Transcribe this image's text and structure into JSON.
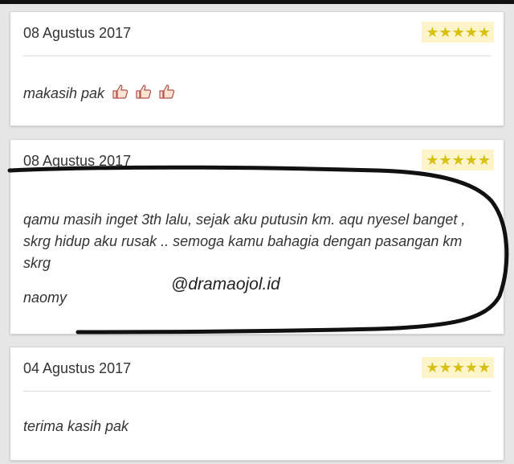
{
  "reviews": [
    {
      "date": "08 Agustus 2017",
      "stars": "★★★★★",
      "text": "makasih pak",
      "emoji": "thumbs-up-icon"
    },
    {
      "date": "08 Agustus 2017",
      "stars": "★★★★★",
      "text": "qamu masih inget 3th lalu, sejak aku putusin km. aqu nyesel banget , skrg hidup aku rusak .. semoga kamu bahagia dengan pasangan km skrg",
      "signature": "naomy"
    },
    {
      "date": "04 Agustus 2017",
      "stars": "★★★★★",
      "text": "terima kasih pak"
    }
  ],
  "watermark": "@dramaojol.id",
  "colors": {
    "star": "#d8c012",
    "star_bg": "#fdf5c9",
    "card": "#ffffff",
    "background": "#e6e6e6",
    "scribble": "#111111"
  }
}
